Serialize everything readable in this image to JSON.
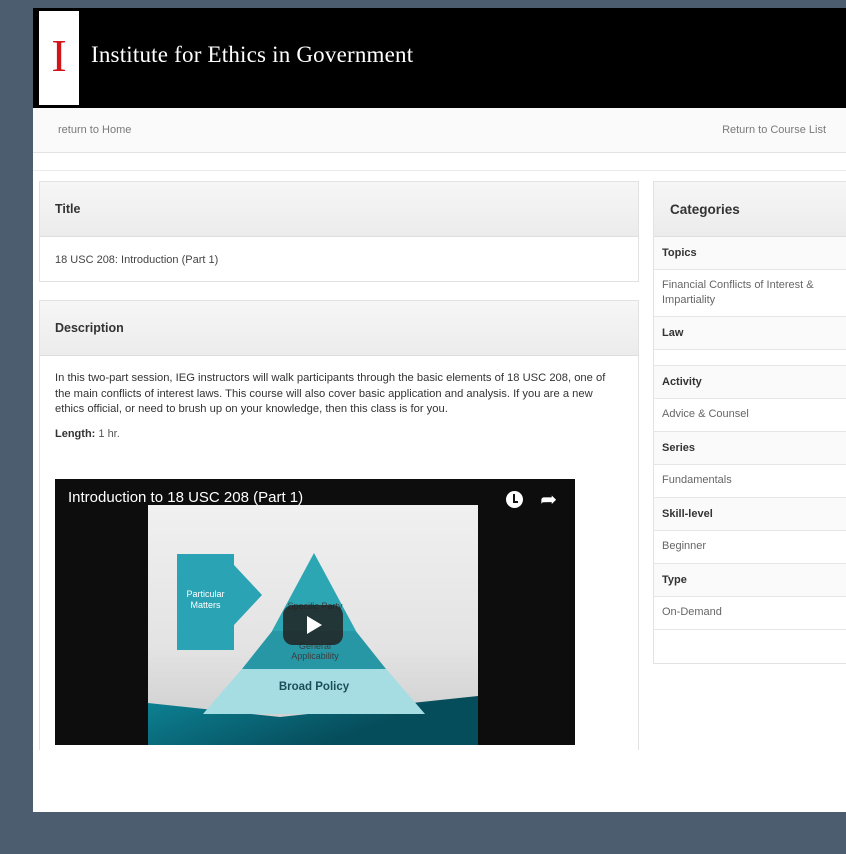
{
  "site": {
    "logo_letter": "I",
    "title": "Institute for Ethics in Government"
  },
  "nav": {
    "home_link": "return to Home",
    "course_list_link": "Return to Course List"
  },
  "title_panel": {
    "heading": "Title",
    "value": "18 USC 208: Introduction (Part 1)"
  },
  "description_panel": {
    "heading": "Description",
    "text": "In this two-part session, IEG instructors will walk participants through the basic elements of 18 USC 208, one of the main conflicts of interest laws. This course will also cover basic application and analysis. If you are a new ethics official, or need to brush up on your knowledge, then this class is for you.",
    "length_label": "Length:",
    "length_value": "1 hr."
  },
  "video": {
    "title": "Introduction to 18 USC 208 (Part 1)",
    "slide": {
      "box_label": "Particular Matters",
      "top_label": "Specific Party",
      "mid_label": "General Applicability",
      "base_label": "Broad Policy"
    }
  },
  "categories": {
    "heading": "Categories",
    "groups": [
      {
        "label": "Topics",
        "value": "Financial Conflicts of Interest & Impartiality"
      },
      {
        "label": "Law",
        "value": ""
      },
      {
        "label": "Activity",
        "value": "Advice & Counsel"
      },
      {
        "label": "Series",
        "value": "Fundamentals"
      },
      {
        "label": "Skill-level",
        "value": "Beginner"
      },
      {
        "label": "Type",
        "value": "On-Demand"
      }
    ]
  },
  "colors": {
    "background": "#4b5d6e",
    "brand_bar": "#000000",
    "logo_red": "#d0161b",
    "slide_teal": "#2aa3b5"
  }
}
